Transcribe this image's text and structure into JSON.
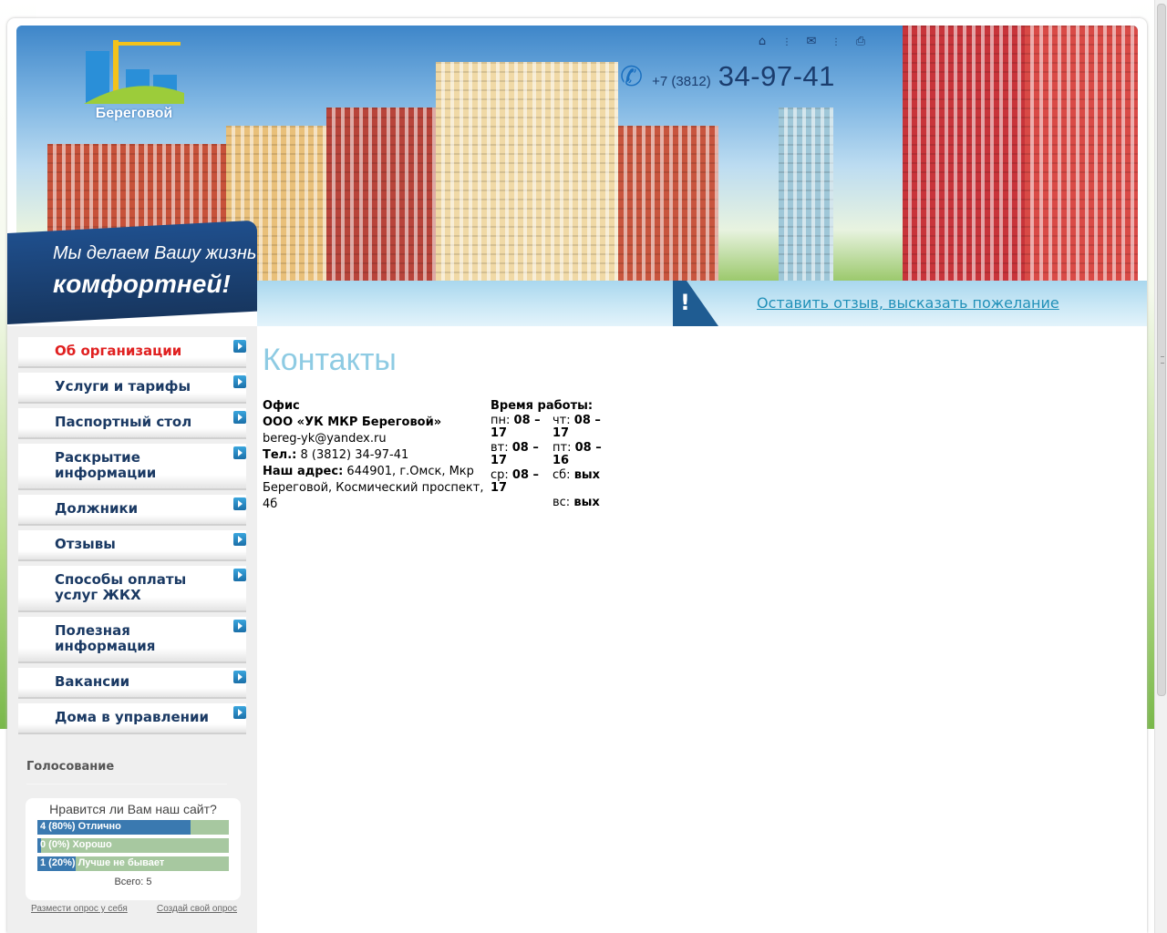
{
  "header": {
    "logo_text": "Береговой",
    "icons": [
      "home-icon",
      "mail-icon",
      "print-icon"
    ],
    "phone_prefix": "+7 (3812)",
    "phone_number": "34-97-41",
    "slogan_line1": "Мы делаем Вашу жизнь",
    "slogan_line2": "комфортней!",
    "feedback_mark": "!",
    "feedback_link": "Оставить отзыв, высказать пожелание"
  },
  "menu": {
    "items": [
      {
        "label": "Об организации",
        "active": true
      },
      {
        "label": "Услуги и тарифы"
      },
      {
        "label": "Паспортный стол"
      },
      {
        "label": "Раскрытие информации"
      },
      {
        "label": "Должники"
      },
      {
        "label": "Отзывы"
      },
      {
        "label": "Способы оплаты услуг ЖКХ"
      },
      {
        "label": "Полезная информация"
      },
      {
        "label": "Вакансии"
      },
      {
        "label": "Дома в управлении"
      }
    ]
  },
  "poll": {
    "section_title": "Голосование",
    "question": "Нравится ли Вам наш сайт?",
    "options": [
      {
        "label": "4 (80%)  Отлично",
        "percent": 80
      },
      {
        "label": "0 (0%)  Хорошо",
        "percent": 0
      },
      {
        "label": "1 (20%)  Лучше не бывает",
        "percent": 20
      }
    ],
    "total": "Всего: 5",
    "link_embed": "Размести опрос у себя",
    "link_create": "Создай свой опрос"
  },
  "content": {
    "title": "Контакты",
    "office_heading": "Офис",
    "org_name": "ООО «УК МКР Береговой»",
    "email": "bereg-yk@yandex.ru",
    "phone_label": "Тел.:",
    "phone_value": " 8 (3812) 34-97-41",
    "address_label": "Наш адрес:",
    "address_value": " 644901, г.Омск, Мкр Береговой, Космический проспект, 4б",
    "hours_title": "Время работы:",
    "hours": [
      {
        "day": "пн:",
        "time": "08 – 17"
      },
      {
        "day": "чт:",
        "time": "08 – 17"
      },
      {
        "day": "вт:",
        "time": "08 – 17"
      },
      {
        "day": "пт:",
        "time": "08 – 16"
      },
      {
        "day": "ср:",
        "time": "08 – 17"
      },
      {
        "day": "сб:",
        "time": "вых"
      },
      {
        "day": "",
        "time": ""
      },
      {
        "day": "вс:",
        "time": "вых"
      }
    ]
  }
}
